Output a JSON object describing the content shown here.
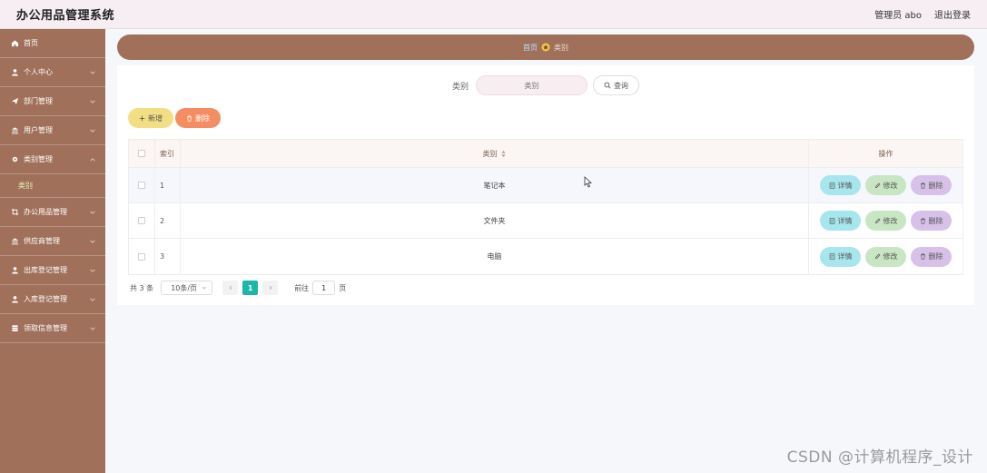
{
  "header": {
    "app_title": "办公用品管理系统",
    "user_label": "管理员 abo",
    "logout_label": "退出登录"
  },
  "sidebar": {
    "items": [
      {
        "label": "首页",
        "icon": "home-icon",
        "has_children": false
      },
      {
        "label": "个人中心",
        "icon": "user-icon",
        "has_children": true
      },
      {
        "label": "部门管理",
        "icon": "send-icon",
        "has_children": true
      },
      {
        "label": "用户管理",
        "icon": "bank-icon",
        "has_children": true
      },
      {
        "label": "类别管理",
        "icon": "gear-icon",
        "has_children": true,
        "expanded": true,
        "children": [
          {
            "label": "类别",
            "active": true
          }
        ]
      },
      {
        "label": "办公用品管理",
        "icon": "crop-icon",
        "has_children": true
      },
      {
        "label": "供应商管理",
        "icon": "bank-icon",
        "has_children": true
      },
      {
        "label": "出库登记管理",
        "icon": "user-icon",
        "has_children": true
      },
      {
        "label": "入库登记管理",
        "icon": "user-icon",
        "has_children": true
      },
      {
        "label": "领取信息管理",
        "icon": "server-icon",
        "has_children": true
      }
    ]
  },
  "breadcrumb": {
    "home": "首页",
    "current": "类别"
  },
  "search": {
    "label": "类别",
    "placeholder": "类别",
    "button_label": "查询"
  },
  "actions": {
    "add_label": "新增",
    "delete_label": "删除"
  },
  "table": {
    "headers": {
      "index": "索引",
      "category": "类别",
      "operations": "操作"
    },
    "rows": [
      {
        "index": "1",
        "category": "笔记本"
      },
      {
        "index": "2",
        "category": "文件夹"
      },
      {
        "index": "3",
        "category": "电脑"
      }
    ],
    "op_labels": {
      "detail": "详情",
      "edit": "修改",
      "remove": "删除"
    }
  },
  "pagination": {
    "total": "共 3 条",
    "page_size": "10条/页",
    "current_page": "1",
    "goto_label": "前往",
    "goto_value": "1",
    "page_suffix": "页"
  },
  "watermark": "CSDN @计算机程序_设计",
  "colors": {
    "sidebar_bg": "#a0705a",
    "header_bg": "#f6eef2",
    "active_page": "#1eb6a6",
    "add_button": "#f2df83",
    "delete_button": "#f48e62",
    "detail_button": "#a7e6ec",
    "edit_button": "#c8e6c4",
    "remove_button": "#d8c1e8"
  }
}
